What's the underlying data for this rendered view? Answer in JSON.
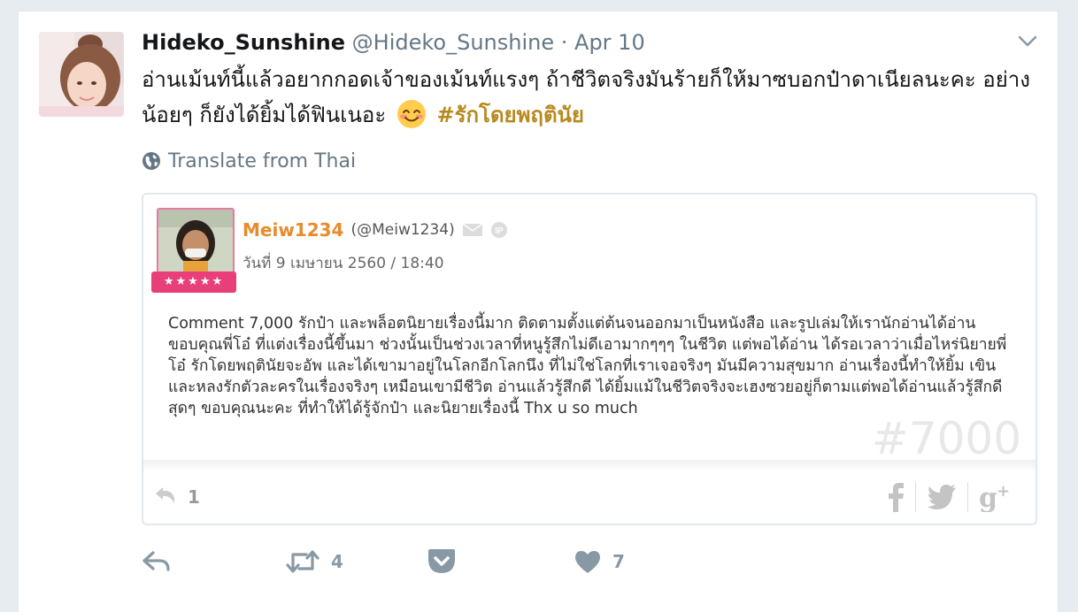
{
  "tweet": {
    "display_name": "Hideko_Sunshine",
    "handle": "@Hideko_Sunshine",
    "separator": "·",
    "date": "Apr 10",
    "text": "อ่านเม้นท์นี้แล้วอยากกอดเจ้าของเม้นท์แรงๆ ถ้าชีวิตจริงมันร้ายก็ให้มาซบอกป๋าดาเนียลนะคะ อย่างน้อยๆ ก็ยังได้ยิ้มได้ฟินเนอะ",
    "emoji": "smiling-face-icon",
    "hashtag": "#รักโดยพฤตินัย",
    "translate_label": "Translate from Thai"
  },
  "quote": {
    "username": "Meiw1234",
    "handle": "(@Meiw1234)",
    "date": "วันที่ 9 เมษายน 2560 / 18:40",
    "stars": "★★★★★",
    "body": "Comment  7,000 รักป๋า และพล็อตนิยายเรื่องนี้มาก ติดตามตั้งแต่ต้นจนออกมาเป็นหนังสือ และรูปเล่มให้เรานักอ่านได้อ่าน ขอบคุณพี่โอ๋ ที่แต่งเรื่องนี้ขึ้นมา ช่วงนั้นเป็นช่วงเวลาที่หนูรู้สึกไม่ดีเอามากๆๆๆ ในชีวิต แต่พอได้อ่าน ได้รอเวลาว่าเมื่อไหร่นิยายพี่โอ๋ รักโดยพฤตินัยจะอัพ และได้เขามาอยู่ในโลกอีกโลกนึง ที่ไม่ใช่โลกที่เราเจอจริงๆ มันมีความสุขมาก อ่านเรื่องนี้ทำให้ยิ้ม เขิน และหลงรักตัวละครในเรื่องจริงๆ เหมือนเขามีชีวิต อ่านแล้วรู้สึกดี ได้ยิ้มแม้ในชีวิตจริงจะเฮงซวยอยู่ก็ตามแต่พอได้อ่านแล้วรู้สึกดีสุดๆ ขอบคุณนะคะ ที่ทำให้ได้รู้จักป๋า และนิยายเรื่องนี้ Thx u so much",
    "watermark": "#7000",
    "reply_count": "1",
    "icons": {
      "mail": "mail-icon",
      "ip": "ip-icon",
      "facebook": "facebook-icon",
      "twitter": "twitter-icon",
      "gplus": "google-plus-icon"
    }
  },
  "actions": {
    "retweet_count": "4",
    "like_count": "7"
  },
  "colors": {
    "hashtag": "#b88a1e",
    "quote_username": "#e88b2b",
    "stars_bg": "#e83f7a",
    "action_icon": "#8899a6"
  }
}
